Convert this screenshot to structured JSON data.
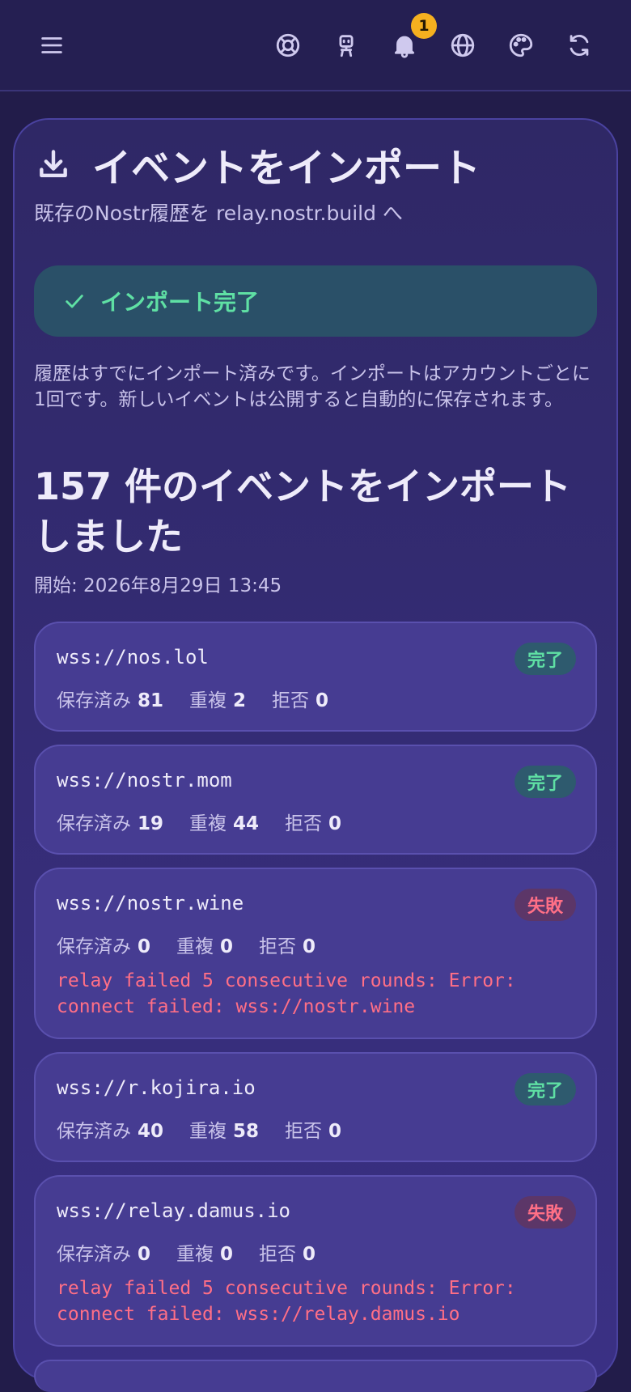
{
  "topbar": {
    "notification_count": "1",
    "icons": [
      "menu-icon",
      "help-icon",
      "robot-icon",
      "bell-icon",
      "globe-icon",
      "palette-icon",
      "refresh-icon"
    ]
  },
  "header": {
    "title": "イベントをインポート",
    "subtitle": "既存のNostr履歴を relay.nostr.build へ"
  },
  "success": {
    "label": "インポート完了"
  },
  "info_text": "履歴はすでにインポート済みです。インポートはアカウントごとに1回です。新しいイベントは公開すると自動的に保存されます。",
  "summary": {
    "headline": "157 件のイベントをインポートしました",
    "started": "開始: 2026年8月29日 13:45"
  },
  "labels": {
    "saved": "保存済み",
    "duplicate": "重複",
    "rejected": "拒否"
  },
  "relays": [
    {
      "url": "wss://nos.lol",
      "status": "完了",
      "saved": "81",
      "duplicate": "2",
      "rejected": "0",
      "error": ""
    },
    {
      "url": "wss://nostr.mom",
      "status": "完了",
      "saved": "19",
      "duplicate": "44",
      "rejected": "0",
      "error": ""
    },
    {
      "url": "wss://nostr.wine",
      "status": "失敗",
      "saved": "0",
      "duplicate": "0",
      "rejected": "0",
      "error": "relay failed 5 consecutive rounds: Error: connect failed: wss://nostr.wine"
    },
    {
      "url": "wss://r.kojira.io",
      "status": "完了",
      "saved": "40",
      "duplicate": "58",
      "rejected": "0",
      "error": ""
    },
    {
      "url": "wss://relay.damus.io",
      "status": "失敗",
      "saved": "0",
      "duplicate": "0",
      "rejected": "0",
      "error": "relay failed 5 consecutive rounds: Error: connect failed: wss://relay.damus.io"
    }
  ],
  "colors": {
    "success": "#5fe0a4",
    "error": "#ff6f86",
    "badge": "#f5b01f"
  }
}
